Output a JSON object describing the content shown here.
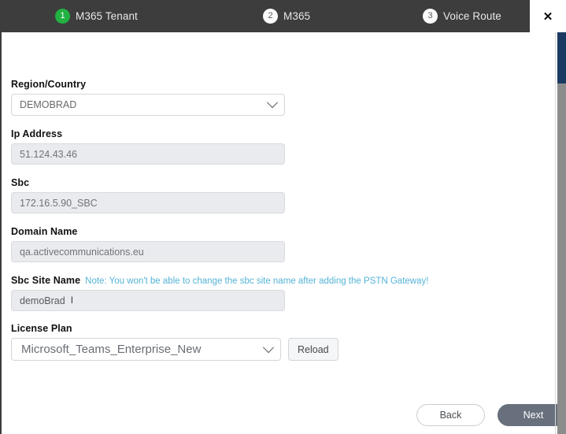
{
  "window": {
    "close_label": "✕"
  },
  "wizard": {
    "steps": [
      {
        "number": "1",
        "label": "M365 Tenant",
        "state": "active"
      },
      {
        "number": "2",
        "label": "M365",
        "state": "inactive"
      },
      {
        "number": "3",
        "label": "Voice Route",
        "state": "inactive"
      }
    ]
  },
  "form": {
    "region": {
      "label": "Region/Country",
      "value": "DEMOBRAD",
      "icon": "chevron-down-icon"
    },
    "ip_address": {
      "label": "Ip Address",
      "value": "51.124.43.46"
    },
    "sbc": {
      "label": "Sbc",
      "value": "172.16.5.90_SBC"
    },
    "domain_name": {
      "label": "Domain Name",
      "value": "qa.activecommunications.eu"
    },
    "sbc_site_name": {
      "label": "Sbc Site Name",
      "note": "Note: You won't be able to change the sbc site name after adding the PSTN Gateway!",
      "value": "demoBrad",
      "cursor": "I"
    },
    "license_plan": {
      "label": "License Plan",
      "value": "Microsoft_Teams_Enterprise_New",
      "icon": "chevron-down-icon",
      "reload_label": "Reload"
    }
  },
  "footer": {
    "back_label": "Back",
    "next_label": "Next"
  },
  "colors": {
    "header_bg": "#3d3d3d",
    "step_active": "#21b241",
    "note_blue": "#54b3d6",
    "next_button": "#68707e",
    "scrollbar_thumb": "#1b3a62"
  }
}
